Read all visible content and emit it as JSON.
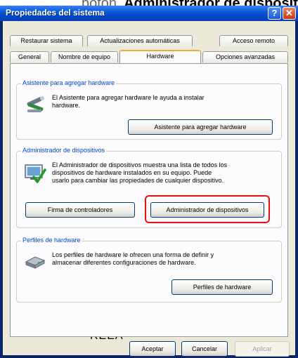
{
  "overlay": {
    "caption_lead": "botón",
    "caption": "Administrador de disposit"
  },
  "window": {
    "title": "Propiedades del sistema"
  },
  "titlebar": {
    "help_label": "?",
    "close_label": "✕"
  },
  "tabs": {
    "row1": [
      "Restaurar sistema",
      "Actualizaciones automáticas",
      "Acceso remoto"
    ],
    "row2": [
      "General",
      "Nombre de equipo",
      "Hardware",
      "Opciones avanzadas"
    ],
    "active": "Hardware"
  },
  "groups": {
    "add_hardware": {
      "legend": "Asistente para agregar hardware",
      "text_line1": "El Asistente para agregar hardware le ayuda a instalar",
      "text_line2": "hardware.",
      "button": "Asistente para agregar hardware"
    },
    "device_manager": {
      "legend": "Administrador de dispositivos",
      "text_line1": "El Administrador de dispositivos muestra una lista de todos los",
      "text_line2": "dispositivos de hardware instalados en su equipo. Puede",
      "text_line3": "usarlo para cambiar las propiedades de cualquier dispositivo.",
      "button_signing": "Firma de controladores",
      "button_manager": "Administrador de dispositivos"
    },
    "profiles": {
      "legend": "Perfiles de hardware",
      "text_line1": "Los perfiles de hardware le ofrecen una forma de definir y",
      "text_line2": "almacenar diferentes configuraciones de hardware.",
      "button": "Perfiles de hardware"
    }
  },
  "watermark": "REEA",
  "footer": {
    "ok": "Aceptar",
    "cancel": "Cancelar",
    "apply": "Aplicar"
  },
  "colors": {
    "title_bar": "#0a5ad8",
    "dialog_bg": "#ece9d8",
    "active_tab_accent": "#f1a939",
    "highlight": "#e8100f",
    "group_legend": "#0046d5"
  }
}
